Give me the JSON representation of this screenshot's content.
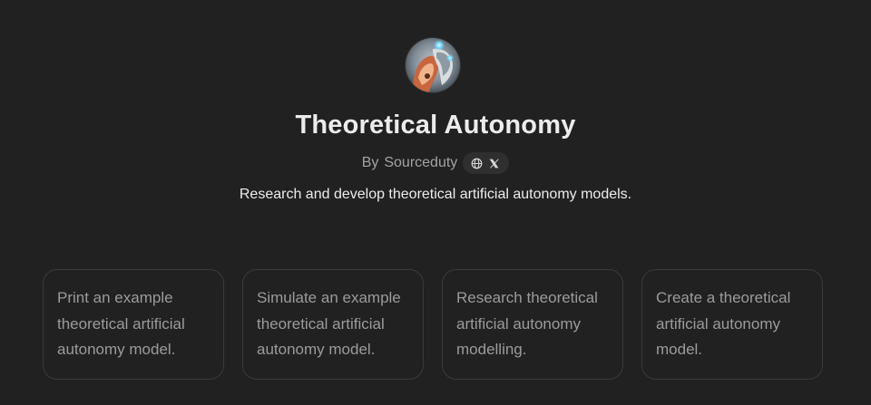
{
  "gpt": {
    "name": "Theoretical Autonomy",
    "by_prefix": "By",
    "author": "Sourceduty",
    "description": "Research and develop theoretical artificial autonomy models."
  },
  "icons": {
    "website": "globe-icon",
    "social": "x-logo-icon"
  },
  "conversation_starters": [
    {
      "label": "Print an example theoretical artificial autonomy model."
    },
    {
      "label": "Simulate an example theoretical artificial autonomy model."
    },
    {
      "label": "Research theoretical artificial autonomy modelling."
    },
    {
      "label": "Create a theoretical artificial autonomy model."
    }
  ],
  "colors": {
    "background": "#212121",
    "card_border": "#3a3a3a",
    "card_text": "#9b9b9b",
    "title": "#ececec",
    "muted": "#a3a3a3"
  }
}
